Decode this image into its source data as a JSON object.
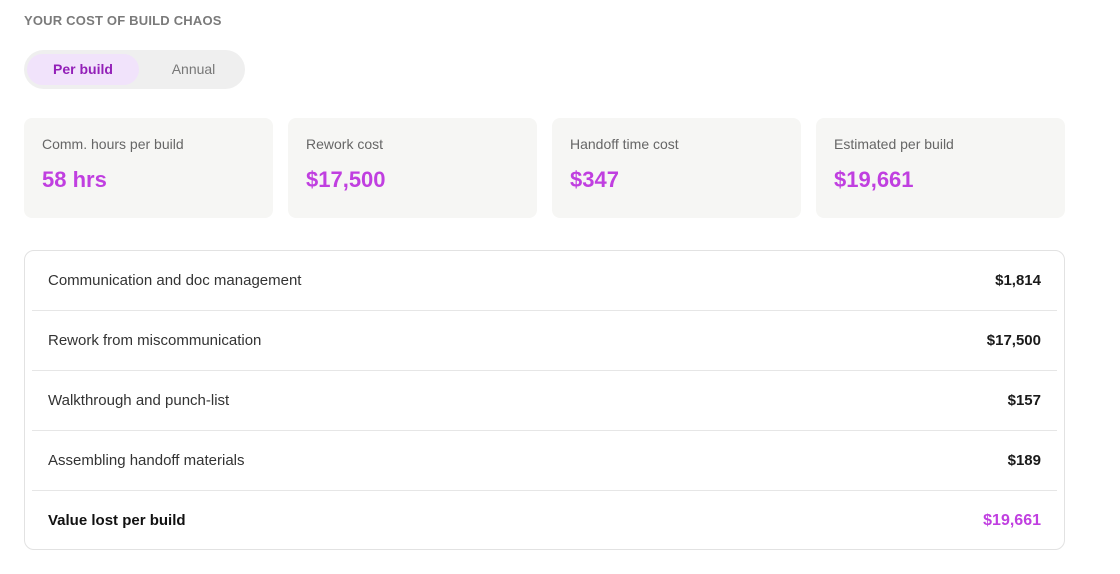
{
  "section": {
    "heading": "YOUR COST OF BUILD CHAOS"
  },
  "toggle": {
    "options": [
      "Per build",
      "Annual"
    ],
    "selected": "Per build"
  },
  "cards": [
    {
      "label": "Comm. hours per build",
      "value": "58 hrs"
    },
    {
      "label": "Rework cost",
      "value": "$17,500"
    },
    {
      "label": "Handoff time cost",
      "value": "$347"
    },
    {
      "label": "Estimated per build",
      "value": "$19,661"
    }
  ],
  "breakdown": {
    "rows": [
      {
        "label": "Communication and doc management",
        "value": "$1,814"
      },
      {
        "label": "Rework from miscommunication",
        "value": "$17,500"
      },
      {
        "label": "Walkthrough and punch-list",
        "value": "$157"
      },
      {
        "label": "Assembling handoff materials",
        "value": "$189"
      }
    ],
    "total": {
      "label": "Value lost per build",
      "value": "$19,661"
    }
  },
  "colors": {
    "accent": "#c03fe0",
    "toggle_active_bg": "#f1e3fb",
    "toggle_active_text": "#9320b8",
    "card_bg": "#f6f6f4"
  }
}
